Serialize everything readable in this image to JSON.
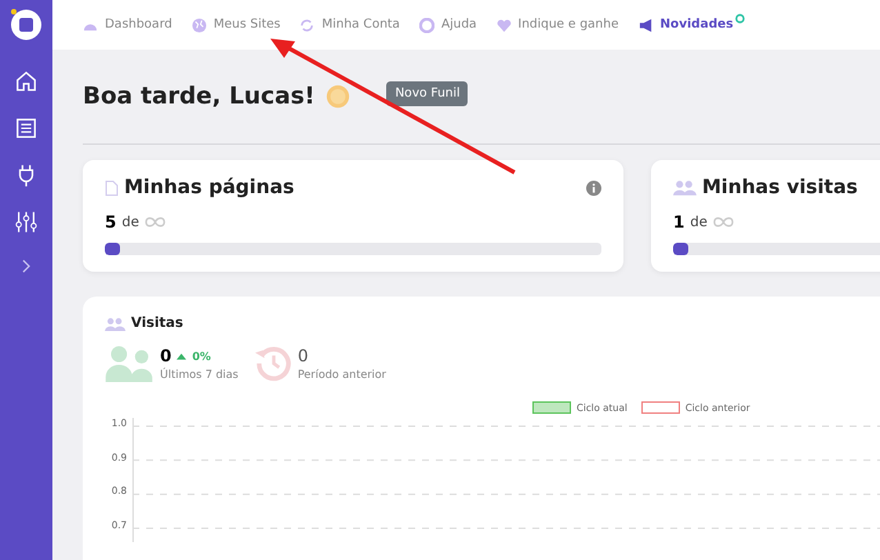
{
  "nav": [
    {
      "label": "Dashboard",
      "highlighted": false
    },
    {
      "label": "Meus Sites",
      "highlighted": false
    },
    {
      "label": "Minha Conta",
      "highlighted": false
    },
    {
      "label": "Ajuda",
      "highlighted": false
    },
    {
      "label": "Indique e ganhe",
      "highlighted": false
    },
    {
      "label": "Novidades",
      "highlighted": true
    }
  ],
  "greeting": "Boa tarde, Lucas!",
  "tooltip": "Novo Funil",
  "cards": [
    {
      "title": "Minhas páginas",
      "count": "5",
      "of": "de",
      "level": 0.03
    },
    {
      "title": "Minhas visitas",
      "count": "1",
      "of": "de",
      "level": 0.03
    }
  ],
  "visits": {
    "title": "Visitas",
    "current": {
      "value": "0",
      "change": "0%",
      "label": "Últimos 7 dias"
    },
    "previous": {
      "value": "0",
      "label": "Período anterior"
    },
    "chart_data": {
      "type": "line",
      "series": [
        {
          "name": "Ciclo atual",
          "color": "#5cc45c"
        },
        {
          "name": "Ciclo anterior",
          "color": "#f08080"
        }
      ],
      "ylim": [
        0.7,
        1
      ],
      "yticks": [
        {
          "value": 1,
          "label": "1.0"
        },
        {
          "value": 0.9,
          "label": "0.9"
        },
        {
          "value": 0.8,
          "label": "0.8"
        },
        {
          "value": 0.7,
          "label": "0.7"
        }
      ]
    }
  }
}
